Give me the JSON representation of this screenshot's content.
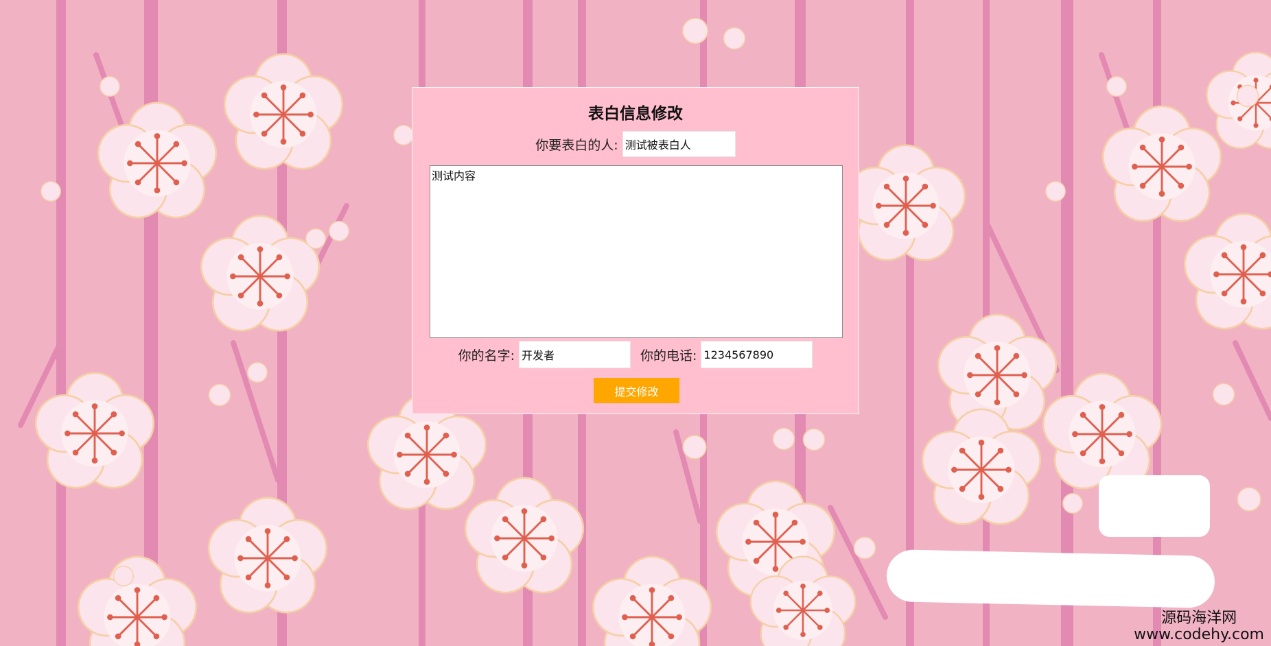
{
  "form": {
    "title": "表白信息修改",
    "target_label": "你要表白的人:",
    "target_value": "测试被表白人",
    "content_value": "测试内容",
    "name_label": "你的名字:",
    "name_value": "开发者",
    "phone_label": "你的电话:",
    "phone_value": "1234567890",
    "submit_label": "提交修改"
  },
  "watermark": {
    "site_name": "源码海洋网",
    "site_url": "www.codehy.com"
  },
  "colors": {
    "background": "#f1b3c4",
    "panel": "#ffbfcf",
    "stem": "#e38ab2",
    "blossom": "#fbe3ea",
    "stamen": "#e0604f",
    "button": "#ffa600"
  },
  "icons": {
    "blossom": "plum-blossom-icon"
  }
}
